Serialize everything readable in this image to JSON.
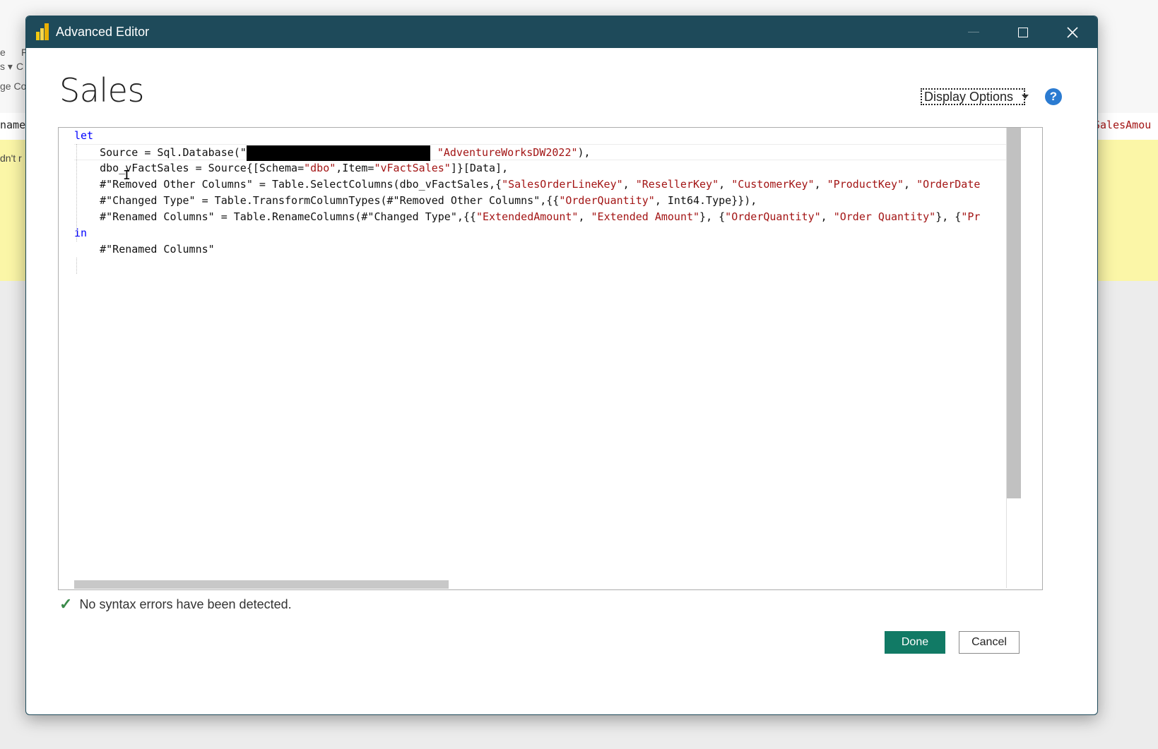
{
  "background": {
    "ribbon_fragments": [
      "e",
      "F",
      "s ▾",
      "C",
      "ge Co"
    ],
    "column_left": "name",
    "column_right": "SalesAmou",
    "yellow_text": "dn't r"
  },
  "dialog": {
    "title": "Advanced Editor",
    "query_name": "Sales",
    "display_options_label": "Display Options",
    "help_label": "?",
    "editor": {
      "lines": [
        {
          "segments": [
            {
              "t": "let",
              "c": "kw"
            }
          ]
        },
        {
          "segments": [
            {
              "t": "    Source = Sql.Database(\"",
              "c": ""
            },
            {
              "redact": true
            },
            {
              "t": "\"AdventureWorksDW2022\"",
              "c": "str"
            },
            {
              "t": "),",
              "c": ""
            }
          ]
        },
        {
          "segments": [
            {
              "t": "    dbo_vFactSales = Source{[Schema=",
              "c": ""
            },
            {
              "t": "\"dbo\"",
              "c": "str"
            },
            {
              "t": ",Item=",
              "c": ""
            },
            {
              "t": "\"vFactSales\"",
              "c": "str"
            },
            {
              "t": "]}[Data],",
              "c": ""
            }
          ]
        },
        {
          "segments": [
            {
              "t": "    #\"Removed Other Columns\" = Table.SelectColumns(dbo_vFactSales,{",
              "c": ""
            },
            {
              "t": "\"SalesOrderLineKey\"",
              "c": "str"
            },
            {
              "t": ", ",
              "c": ""
            },
            {
              "t": "\"ResellerKey\"",
              "c": "str"
            },
            {
              "t": ", ",
              "c": ""
            },
            {
              "t": "\"CustomerKey\"",
              "c": "str"
            },
            {
              "t": ", ",
              "c": ""
            },
            {
              "t": "\"ProductKey\"",
              "c": "str"
            },
            {
              "t": ", ",
              "c": ""
            },
            {
              "t": "\"OrderDate",
              "c": "str"
            }
          ]
        },
        {
          "segments": [
            {
              "t": "    #\"Changed Type\" = Table.TransformColumnTypes(#\"Removed Other Columns\",{{",
              "c": ""
            },
            {
              "t": "\"OrderQuantity\"",
              "c": "str"
            },
            {
              "t": ", Int64.Type}}),",
              "c": ""
            }
          ]
        },
        {
          "segments": [
            {
              "t": "    #\"Renamed Columns\" = Table.RenameColumns(#\"Changed Type\",{{",
              "c": ""
            },
            {
              "t": "\"ExtendedAmount\"",
              "c": "str"
            },
            {
              "t": ", ",
              "c": ""
            },
            {
              "t": "\"Extended Amount\"",
              "c": "str"
            },
            {
              "t": "}, {",
              "c": ""
            },
            {
              "t": "\"OrderQuantity\"",
              "c": "str"
            },
            {
              "t": ", ",
              "c": ""
            },
            {
              "t": "\"Order Quantity\"",
              "c": "str"
            },
            {
              "t": "}, {",
              "c": ""
            },
            {
              "t": "\"Pr",
              "c": "str"
            }
          ]
        },
        {
          "segments": [
            {
              "t": "in",
              "c": "kw"
            }
          ]
        },
        {
          "segments": [
            {
              "t": "    #\"Renamed Columns\"",
              "c": ""
            }
          ]
        }
      ]
    },
    "status_message": "No syntax errors have been detected.",
    "done_label": "Done",
    "cancel_label": "Cancel"
  },
  "colors": {
    "titlebar": "#1e4a5a",
    "keyword": "#0000ff",
    "string": "#a31515",
    "done_button": "#117a65",
    "status_check": "#3a8a4a"
  },
  "icons": [
    "powerbi-app-icon",
    "minimize-icon",
    "maximize-icon",
    "close-icon",
    "chevron-down-icon",
    "help-icon",
    "checkmark-icon",
    "text-cursor-icon"
  ]
}
